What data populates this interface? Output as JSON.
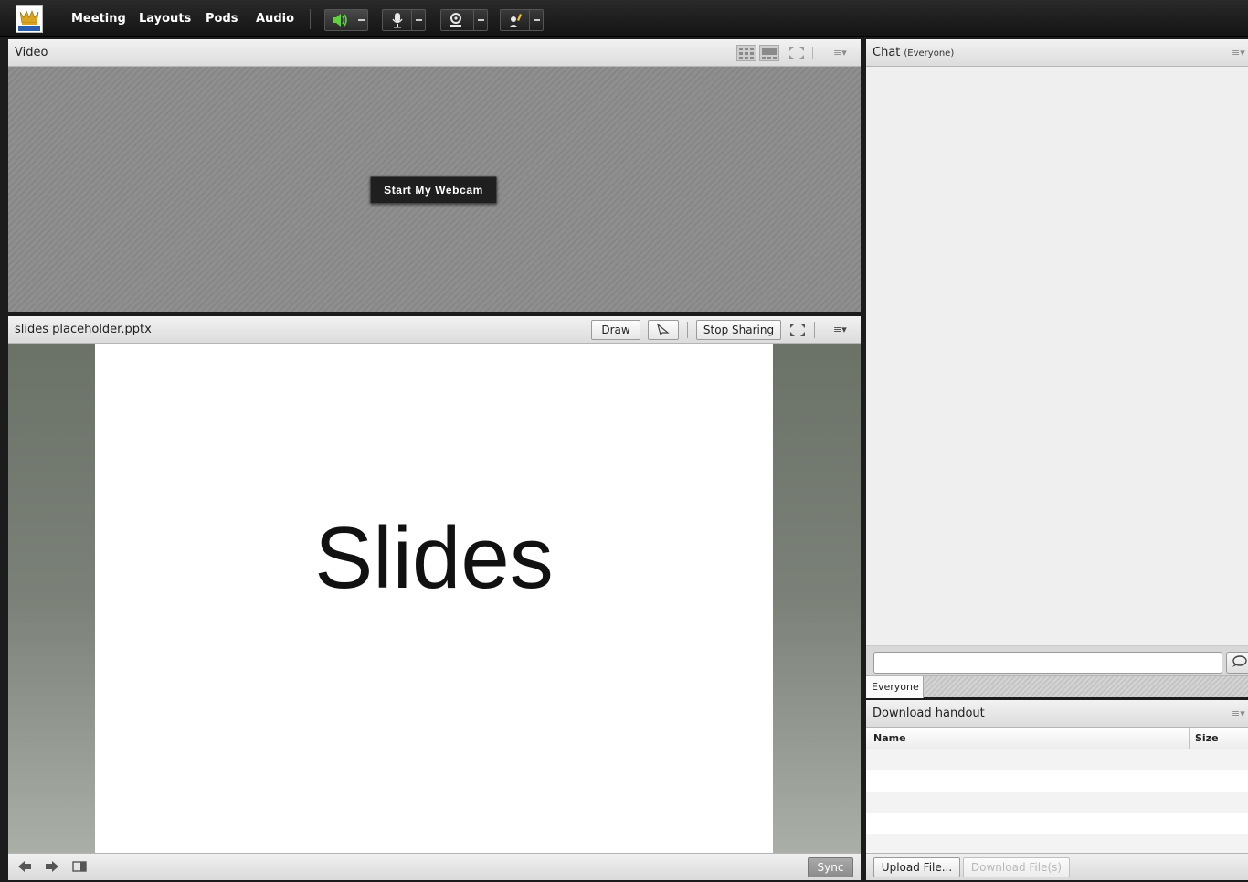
{
  "topbar": {
    "menus": [
      "Meeting",
      "Layouts",
      "Pods",
      "Audio"
    ],
    "speaker_color": "#5ed23f"
  },
  "video_pod": {
    "title": "Video",
    "start_webcam_label": "Start My Webcam"
  },
  "share_pod": {
    "title": "slides placeholder.pptx",
    "draw_label": "Draw",
    "stop_sharing_label": "Stop Sharing",
    "slide_text": "Slides",
    "sync_label": "Sync"
  },
  "chat_pod": {
    "title": "Chat",
    "scope": "(Everyone)",
    "input_value": "",
    "tab_label": "Everyone"
  },
  "file_pod": {
    "title": "Download handout",
    "columns": [
      "Name",
      "Size"
    ],
    "rows": [],
    "upload_label": "Upload File...",
    "download_label": "Download File(s)"
  }
}
